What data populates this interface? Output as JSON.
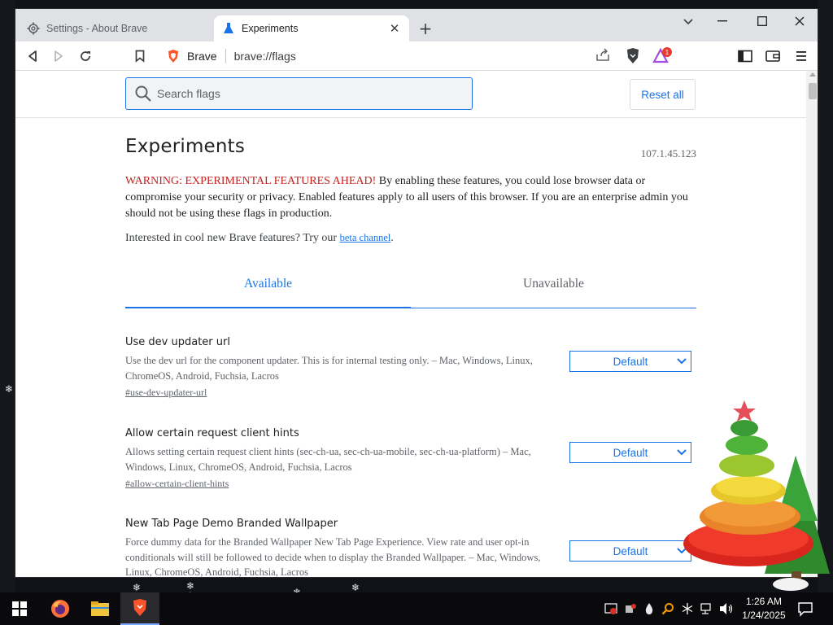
{
  "browser": {
    "tabs": [
      {
        "title": "Settings - About Brave",
        "icon": "gear-icon",
        "active": false
      },
      {
        "title": "Experiments",
        "icon": "flask-icon",
        "active": true
      }
    ],
    "omnibox": {
      "site_label": "Brave",
      "url": "brave://flags"
    },
    "rewards_badge": "1",
    "accent_color": "#1a73e8"
  },
  "page": {
    "search": {
      "placeholder": "Search flags",
      "value": ""
    },
    "reset_label": "Reset all",
    "title": "Experiments",
    "version": "107.1.45.123",
    "warning_red": "WARNING: EXPERIMENTAL FEATURES AHEAD!",
    "warning_text": " By enabling these features, you could lose browser data or compromise your security or privacy. Enabled features apply to all users of this browser. If you are an enterprise admin you should not be using these flags in production.",
    "interested_text": "Interested in cool new Brave features? Try our ",
    "beta_link": "beta channel",
    "interested_end": ".",
    "tabs": {
      "available": "Available",
      "unavailable": "Unavailable"
    },
    "flags": [
      {
        "name": "Use dev updater url",
        "description": "Use the dev url for the component updater. This is for internal testing only. – Mac, Windows, Linux, ChromeOS, Android, Fuchsia, Lacros",
        "link": "#use-dev-updater-url",
        "value": "Default"
      },
      {
        "name": "Allow certain request client hints",
        "description": "Allows setting certain request client hints (sec-ch-ua, sec-ch-ua-mobile, sec-ch-ua-platform) – Mac, Windows, Linux, ChromeOS, Android, Fuchsia, Lacros",
        "link": "#allow-certain-client-hints",
        "value": "Default"
      },
      {
        "name": "New Tab Page Demo Branded Wallpaper",
        "description": "Force dummy data for the Branded Wallpaper New Tab Page Experience. View rate and user opt-in conditionals will still be followed to decide when to display the Branded Wallpaper. – Mac, Windows, Linux, ChromeOS, Android, Fuchsia, Lacros",
        "link": "",
        "value": "Default"
      }
    ]
  },
  "taskbar": {
    "apps": [
      "start-icon",
      "firefox-icon",
      "file-explorer-icon",
      "brave-icon"
    ],
    "time": "1:26 AM",
    "date": "1/24/2025"
  }
}
